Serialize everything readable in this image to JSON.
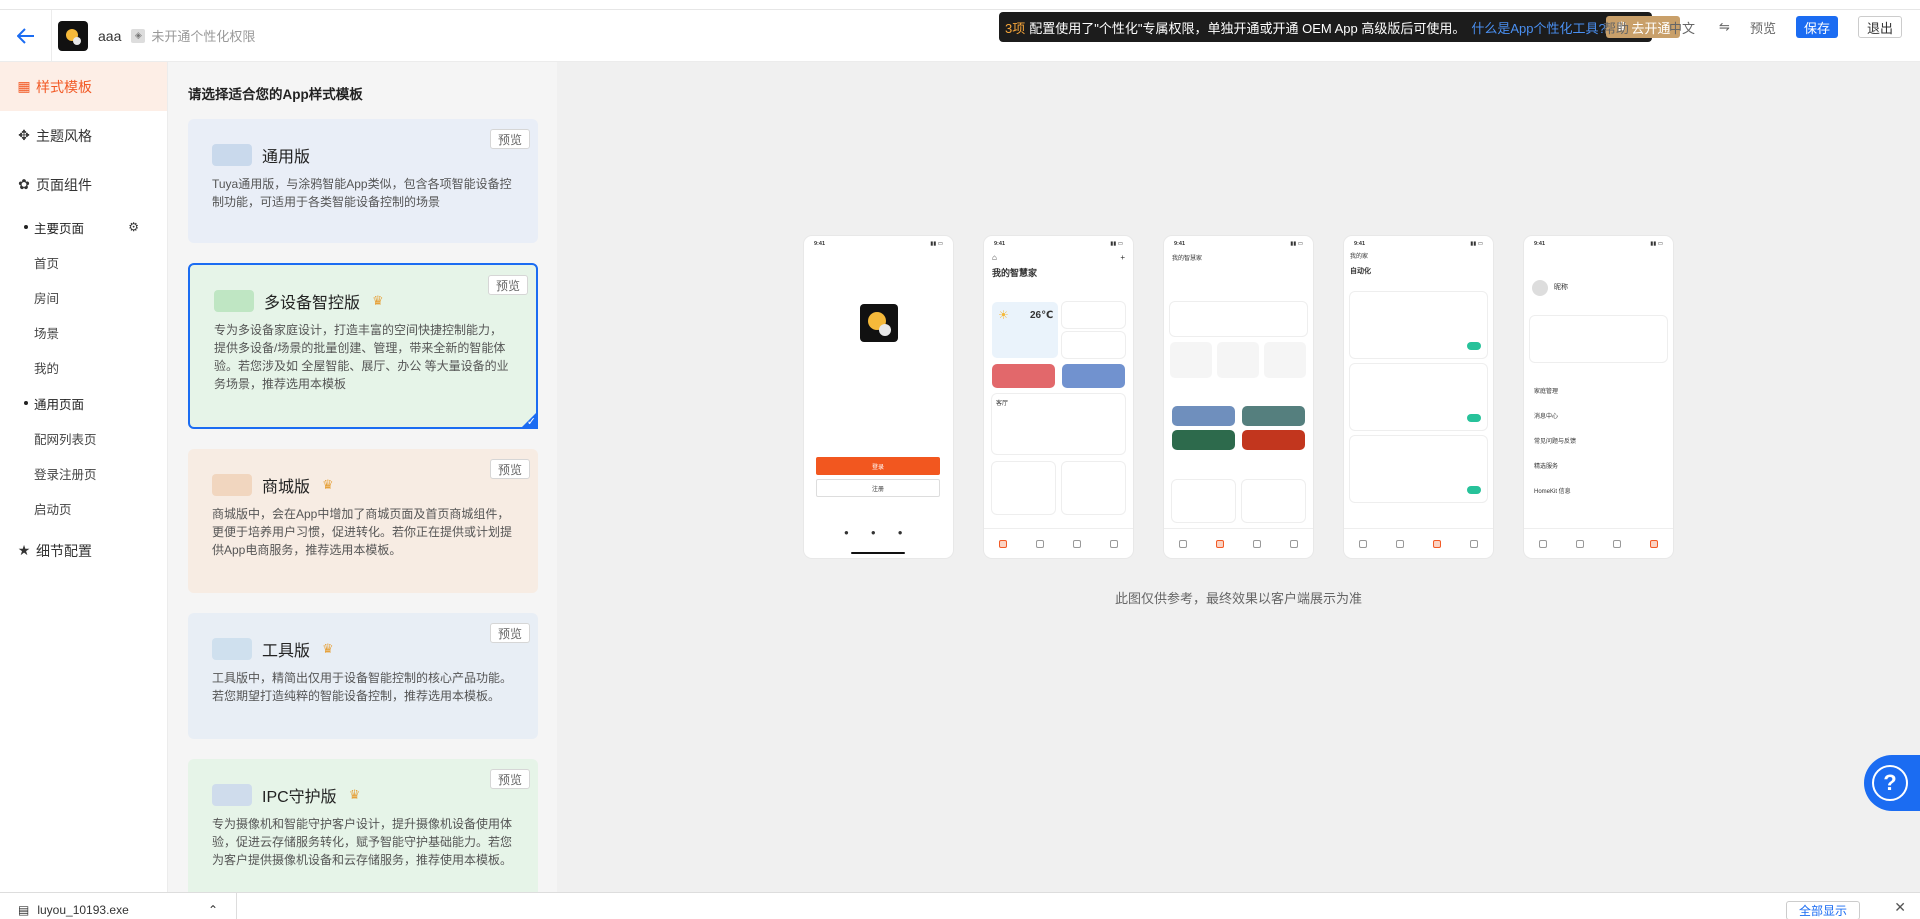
{
  "header": {
    "app_name": "aaa",
    "perm_badge": "◈",
    "perm_text": "未开通个性化权限",
    "banner": {
      "count": "3项",
      "message": "配置使用了\"个性化\"专属权限，单独开通或开通 OEM App 高级版后可使用。",
      "link": "什么是App个性化工具?",
      "open_button": "去开通"
    },
    "help": "帮助",
    "language": "中文",
    "preview": "预览",
    "save": "保存",
    "exit": "退出"
  },
  "sidebar": {
    "items": [
      {
        "label": "样式模板",
        "icon": "grid-icon",
        "active": true
      },
      {
        "label": "主题风格",
        "icon": "palette-icon"
      },
      {
        "label": "页面组件",
        "icon": "component-icon"
      },
      {
        "label": "细节配置",
        "icon": "star-icon"
      }
    ],
    "groups": {
      "main": "主要页面",
      "main_items": [
        "首页",
        "房间",
        "场景",
        "我的"
      ],
      "common": "通用页面",
      "common_items": [
        "配网列表页",
        "登录注册页",
        "启动页"
      ]
    }
  },
  "templates": {
    "title": "请选择适合您的App样式模板",
    "preview_label": "预览",
    "cards": [
      {
        "name": "通用版",
        "desc": "Tuya通用版，与涂鸦智能App类似，包含各项智能设备控制功能，可适用于各类智能设备控制的场景",
        "crown": "",
        "bg": "#e9eef7",
        "thumb": "#c9d9ec"
      },
      {
        "name": "多设备智控版",
        "desc": "专为多设备家庭设计，打造丰富的空间快捷控制能力，提供多设备/场景的批量创建、管理，带来全新的智能体验。若您涉及如 全屋智能、展厅、办公 等大量设备的业务场景，推荐选用本模板",
        "crown": "♛",
        "bg": "#e6f4e8",
        "thumb": "#bfe6c3",
        "selected": true
      },
      {
        "name": "商城版",
        "desc": "商城版中，会在App中增加了商城页面及首页商城组件，更便于培养用户习惯，促进转化。若你正在提供或计划提供App电商服务，推荐选用本模板。",
        "crown": "♛",
        "bg": "#f7ece3",
        "thumb": "#f1d6bf"
      },
      {
        "name": "工具版",
        "desc": "工具版中，精简出仅用于设备智能控制的核心产品功能。若您期望打造纯粹的智能设备控制，推荐选用本模板。",
        "crown": "♛",
        "bg": "#e8eef5",
        "thumb": "#cfe0ee"
      },
      {
        "name": "IPC守护版",
        "desc": "专为摄像机和智能守护客户设计，提升摄像机设备使用体验，促进云存储服务转化，赋予智能守护基础能力。若您为客户提供摄像机设备和云存储服务，推荐使用本模板。",
        "crown": "♛",
        "bg": "#e6f4e8",
        "thumb": "#cfdcec"
      }
    ]
  },
  "phones": {
    "time": "9:41",
    "login_button": "登录",
    "register_button": "注册",
    "home_title": "我的智慧家",
    "temperature": "26℃",
    "room": "客厅",
    "manage": "我的家",
    "auto": "自动化",
    "nickname": "昵称",
    "menu": [
      "家庭管理",
      "消息中心",
      "常见问题与反馈",
      "精选服务",
      "HomeKit 信息"
    ]
  },
  "note": "此图仅供参考，最终效果以客户端展示为准",
  "download": {
    "file": "luyou_10193.exe",
    "show_all": "全部显示"
  }
}
